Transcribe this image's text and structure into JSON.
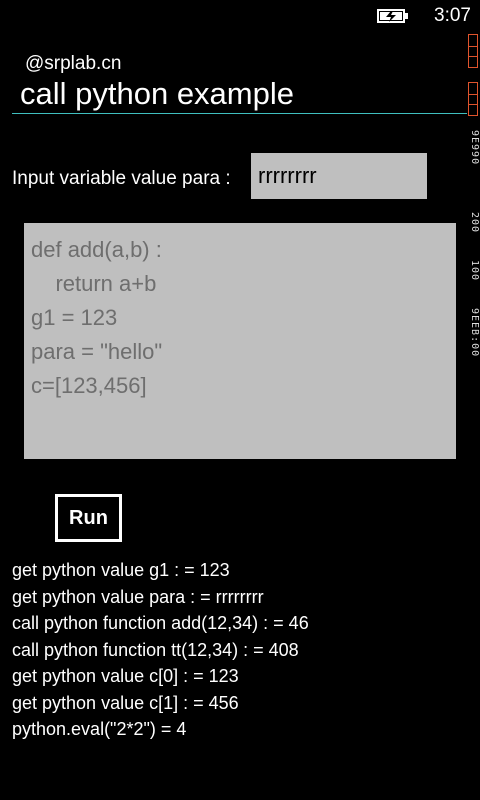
{
  "status_bar": {
    "time": "3:07",
    "battery_icon": "battery-charging-icon"
  },
  "debug_overlay": {
    "counter_1": "9EEB:00",
    "counter_2": "100",
    "counter_3": "200",
    "counter_4": "9E990",
    "colors": {
      "warning": "#e0542d"
    }
  },
  "header": {
    "app_name": "@srplab.cn",
    "title": "call python example",
    "accent_color": "#3fbfbf"
  },
  "input_row": {
    "label": "Input variable value para :",
    "value": "rrrrrrrr"
  },
  "code": {
    "lines": [
      "def add(a,b) :",
      "    return a+b",
      "g1 = 123",
      "para = \"hello\"",
      "c=[123,456]"
    ]
  },
  "run_button": {
    "label": "Run"
  },
  "output": {
    "lines": [
      "get python value g1 : = 123",
      "get python value para : = rrrrrrrr",
      "call python function add(12,34) : = 46",
      "call python function tt(12,34) : = 408",
      "get python value c[0] : = 123",
      "get python value c[1] : = 456",
      "python.eval(\"2*2\") = 4"
    ]
  }
}
